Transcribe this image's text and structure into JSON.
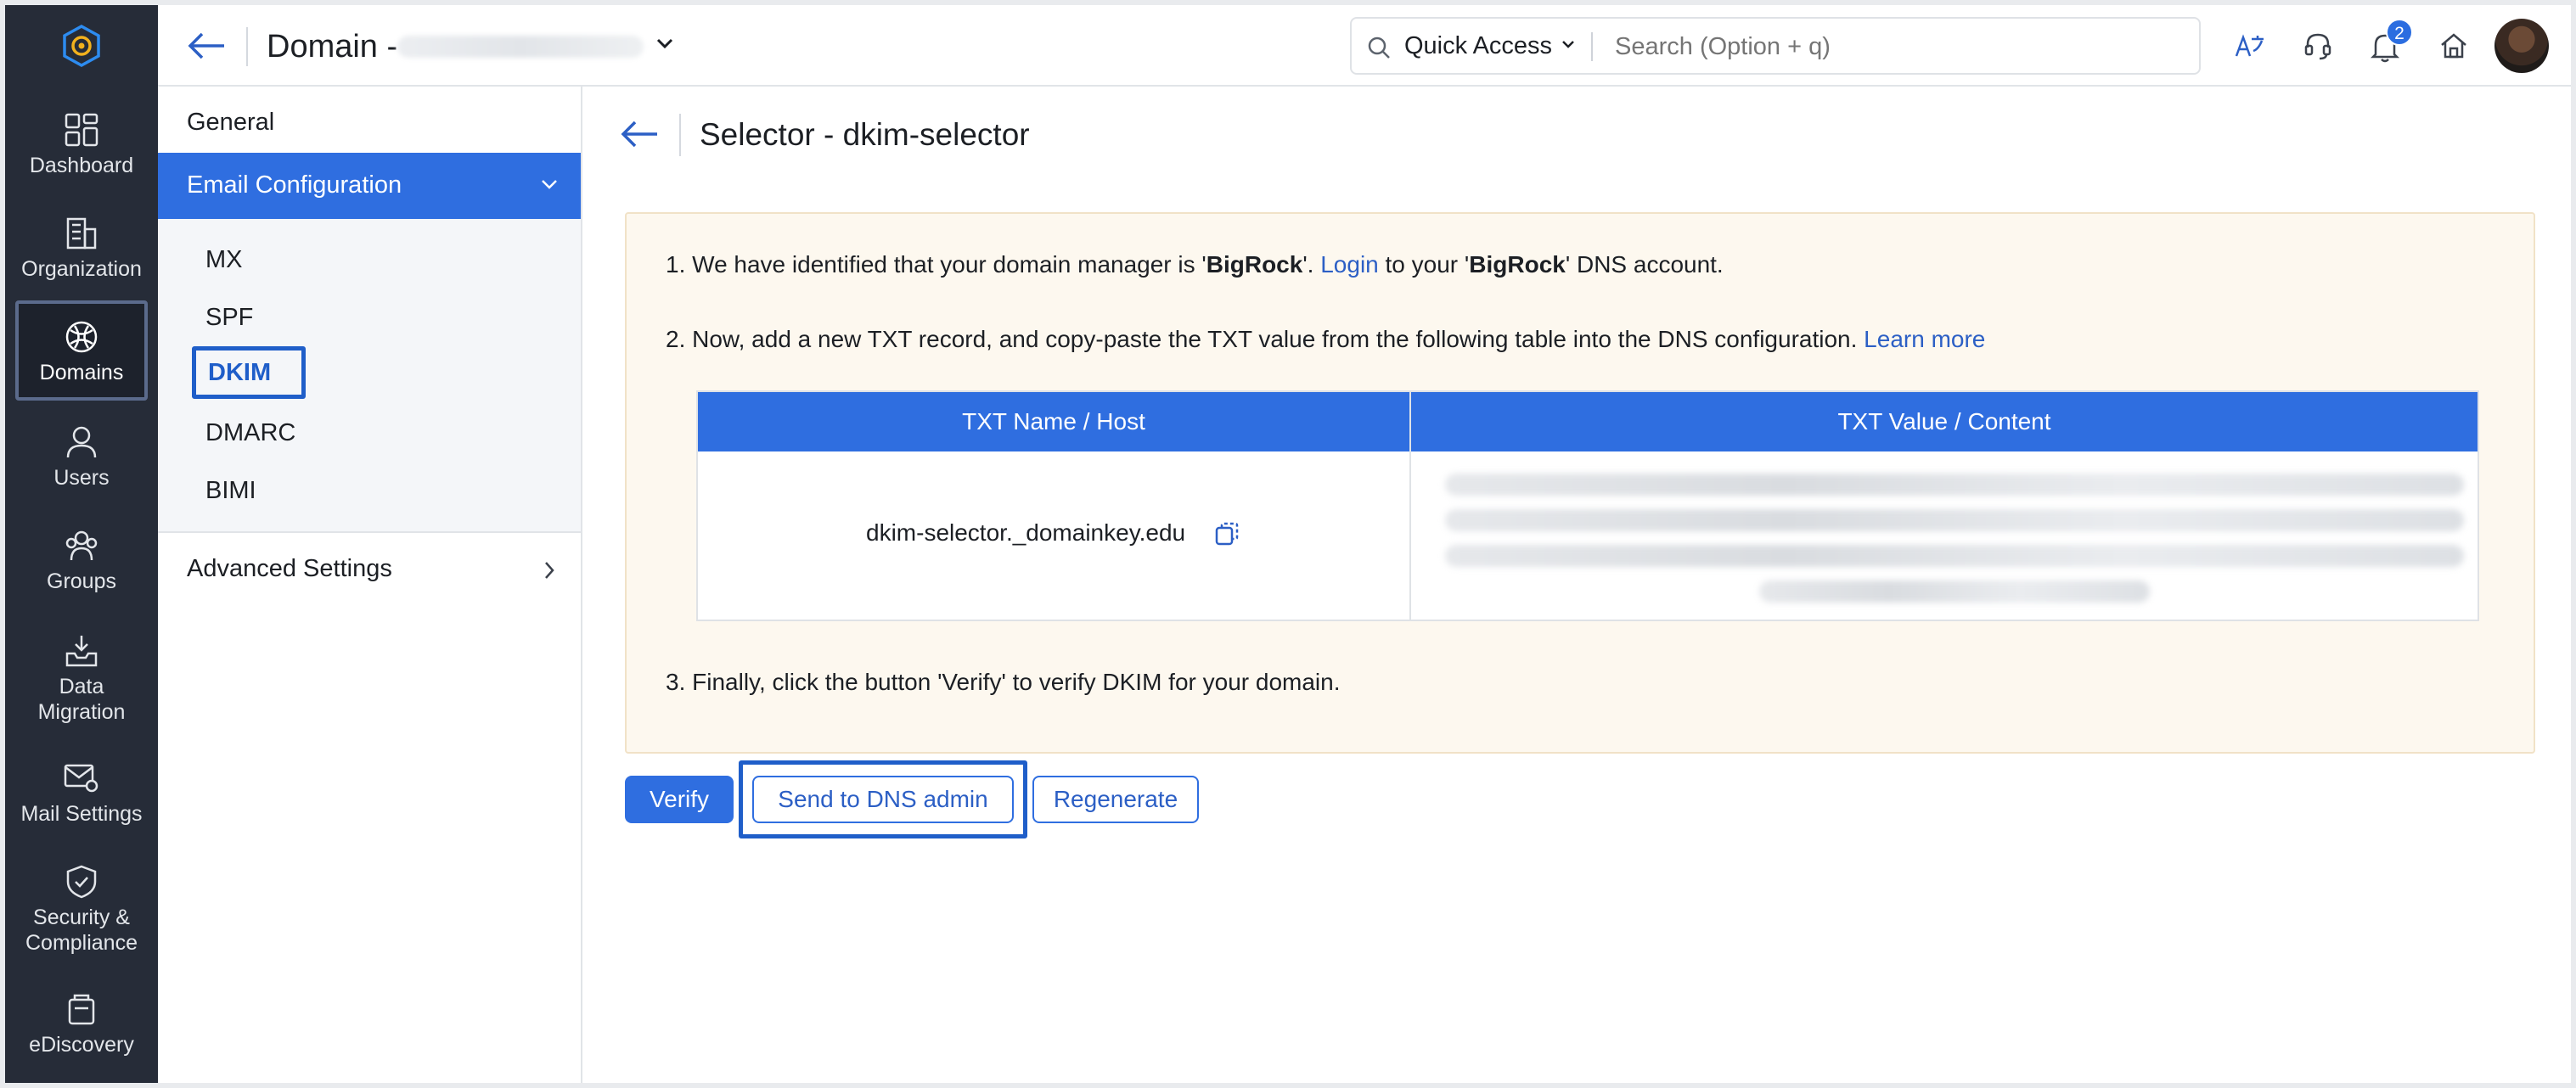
{
  "rail": {
    "items": [
      {
        "label": "Dashboard",
        "icon": "dashboard-icon"
      },
      {
        "label": "Organization",
        "icon": "organization-icon"
      },
      {
        "label": "Domains",
        "icon": "domains-icon",
        "active": true
      },
      {
        "label": "Users",
        "icon": "users-icon"
      },
      {
        "label": "Groups",
        "icon": "groups-icon"
      },
      {
        "label": "Data Migration",
        "icon": "data-migration-icon"
      },
      {
        "label": "Mail Settings",
        "icon": "mail-settings-icon"
      },
      {
        "label": "Security & Compliance",
        "icon": "security-icon"
      },
      {
        "label": "eDiscovery",
        "icon": "ediscovery-icon"
      }
    ]
  },
  "header": {
    "title": "Domain -",
    "quick_access": "Quick Access",
    "search_placeholder": "Search (Option + q)",
    "notification_count": "2"
  },
  "subnav": {
    "general": "General",
    "email_config": "Email Configuration",
    "items": [
      "MX",
      "SPF",
      "DKIM",
      "DMARC",
      "BIMI"
    ],
    "active_item": "DKIM",
    "advanced": "Advanced Settings"
  },
  "main": {
    "title": "Selector - dkim-selector",
    "step1": {
      "num": "1.",
      "pre": "We have identified that your domain manager is '",
      "manager": "BigRock",
      "mid": "'. ",
      "login": "Login",
      "post1": " to your '",
      "manager2": "BigRock",
      "post2": "' DNS account."
    },
    "step2": {
      "num": "2.",
      "text": "Now, add a new TXT record, and copy-paste the TXT value from the following table into the DNS configuration.",
      "learn_more": "Learn more"
    },
    "table": {
      "headers": [
        "TXT Name / Host",
        "TXT Value / Content"
      ],
      "host": "dkim-selector._domainkey.edu"
    },
    "step3": {
      "num": "3.",
      "text": "Finally, click the button 'Verify' to verify DKIM for your domain."
    },
    "buttons": {
      "verify": "Verify",
      "send": "Send to DNS admin",
      "regenerate": "Regenerate"
    }
  },
  "colors": {
    "accent": "#2f6ee0",
    "rail_bg": "#262c38",
    "panel_bg": "#fdf8ef"
  }
}
